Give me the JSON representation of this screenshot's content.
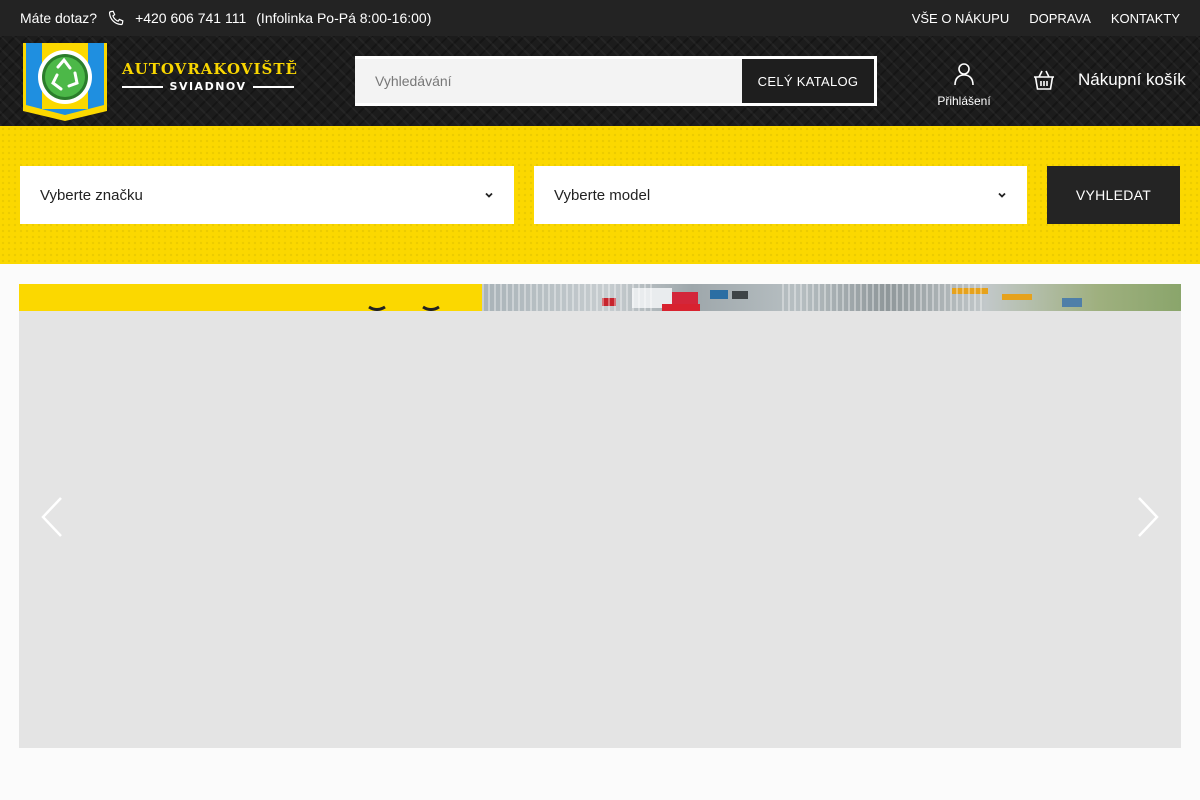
{
  "topbar": {
    "question": "Máte dotaz?",
    "phone": "+420 606 741 111",
    "hours": "(Infolinka Po-Pá 8:00-16:00)",
    "links": [
      "VŠE O NÁKUPU",
      "DOPRAVA",
      "KONTAKTY"
    ]
  },
  "header": {
    "brand_line1": "AUTOVRAKOVIŠTĚ",
    "brand_line2": "SVIADNOV",
    "search_placeholder": "Vyhledávání",
    "catalog_button": "CELÝ KATALOG",
    "login_label": "Přihlášení",
    "cart_label": "Nákupní košík"
  },
  "filter": {
    "brand_select": "Vyberte značku",
    "model_select": "Vyberte model",
    "search_button": "VYHLEDAT"
  },
  "icons": {
    "phone": "phone-icon",
    "logo": "recycle-logo-icon",
    "user": "user-icon",
    "cart": "basket-icon",
    "chevron": "chevron-down-icon",
    "prev": "chevron-left-icon",
    "next": "chevron-right-icon"
  },
  "colors": {
    "accent_yellow": "#fbd800",
    "dark": "#232323",
    "logo_blue": "#1f8fe0",
    "logo_green": "#3aa335"
  }
}
